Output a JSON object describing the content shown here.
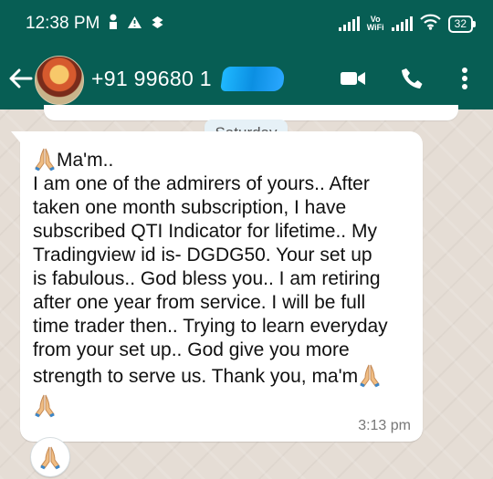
{
  "status": {
    "time": "12:38 PM",
    "vowifi_top": "Vo",
    "vowifi_bottom": "WiFi",
    "battery": "32"
  },
  "chat": {
    "contact_visible": "+91 99680 1",
    "icons": [
      "back-arrow-icon",
      "video-call-icon",
      "phone-icon",
      "more-vert-icon"
    ]
  },
  "date_label": "Saturday",
  "message": {
    "lines": [
      "Ma'm..",
      "I am one of the admirers of yours.. After",
      "taken one month subscription, I have",
      "subscribed QTI Indicator for lifetime.. My",
      "Tradingview id is- DGDG50. Your set up",
      "is fabulous.. God bless you.. I am retiring",
      "after one year from service. I will be full",
      "time trader then.. Trying to learn everyday",
      "from your set up.. God give you more",
      "strength to serve us. Thank you, ma'm"
    ],
    "time": "3:13 pm"
  },
  "colors": {
    "header": "#075e54",
    "chat_background": "#e5ddd5",
    "bubble": "#ffffff",
    "date_chip": "#e6f1f7",
    "redaction": "#0b8fe2"
  }
}
